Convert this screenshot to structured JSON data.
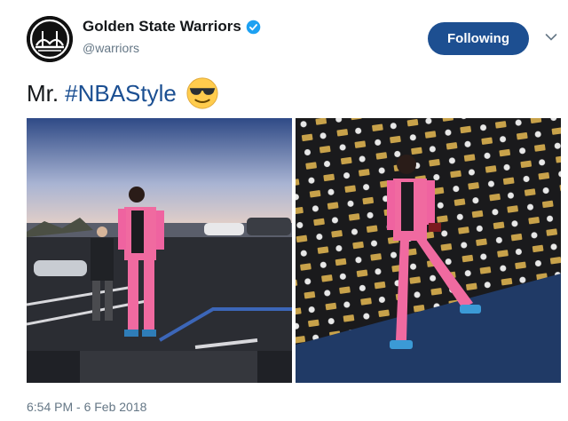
{
  "account": {
    "display_name": "Golden State Warriors",
    "handle": "@warriors",
    "verified_icon": "verified-badge-icon",
    "avatar_icon": "warriors-bridge-logo"
  },
  "follow_button": {
    "label": "Following"
  },
  "menu_icon": "chevron-down-icon",
  "tweet": {
    "text": "Mr.",
    "hashtag": "#NBAStyle",
    "emoji": "sunglasses-emoji"
  },
  "media": [
    {
      "name": "parking-lot-photo",
      "description_icon": "photo"
    },
    {
      "name": "step-and-repeat-photo",
      "description_icon": "photo"
    }
  ],
  "timestamp": "6:54 PM - 6 Feb 2018",
  "colors": {
    "accent": "#1d4f91",
    "hashtag": "#1b4f92",
    "outfit_pink": "#f06aa0"
  }
}
